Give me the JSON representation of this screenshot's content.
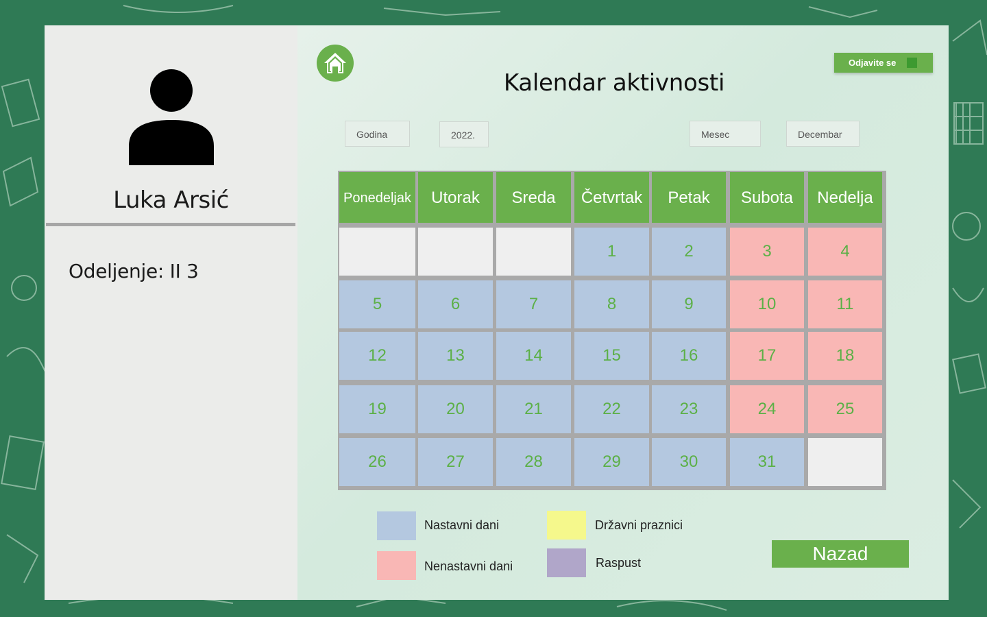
{
  "sidebar": {
    "user_name": "Luka Arsić",
    "class_label": "Odeljenje: II 3"
  },
  "header": {
    "title": "Kalendar aktivnosti",
    "logout_label": "Odjavite se"
  },
  "filters": {
    "year_label": "Godina",
    "year_value": "2022.",
    "month_label": "Mesec",
    "month_value": "Decembar"
  },
  "calendar": {
    "weekdays": [
      "Ponedeljak",
      "Utorak",
      "Sreda",
      "Četvrtak",
      "Petak",
      "Subota",
      "Nedelja"
    ],
    "weeks": [
      [
        {
          "day": "",
          "type": "empty"
        },
        {
          "day": "",
          "type": "empty"
        },
        {
          "day": "",
          "type": "empty"
        },
        {
          "day": "1",
          "type": "work"
        },
        {
          "day": "2",
          "type": "work"
        },
        {
          "day": "3",
          "type": "off"
        },
        {
          "day": "4",
          "type": "off"
        }
      ],
      [
        {
          "day": "5",
          "type": "work"
        },
        {
          "day": "6",
          "type": "work"
        },
        {
          "day": "7",
          "type": "work"
        },
        {
          "day": "8",
          "type": "work"
        },
        {
          "day": "9",
          "type": "work"
        },
        {
          "day": "10",
          "type": "off"
        },
        {
          "day": "11",
          "type": "off"
        }
      ],
      [
        {
          "day": "12",
          "type": "work"
        },
        {
          "day": "13",
          "type": "work"
        },
        {
          "day": "14",
          "type": "work"
        },
        {
          "day": "15",
          "type": "work"
        },
        {
          "day": "16",
          "type": "work"
        },
        {
          "day": "17",
          "type": "off"
        },
        {
          "day": "18",
          "type": "off"
        }
      ],
      [
        {
          "day": "19",
          "type": "work"
        },
        {
          "day": "20",
          "type": "work"
        },
        {
          "day": "21",
          "type": "work"
        },
        {
          "day": "22",
          "type": "work"
        },
        {
          "day": "23",
          "type": "work"
        },
        {
          "day": "24",
          "type": "off"
        },
        {
          "day": "25",
          "type": "off"
        }
      ],
      [
        {
          "day": "26",
          "type": "work"
        },
        {
          "day": "27",
          "type": "work"
        },
        {
          "day": "28",
          "type": "work"
        },
        {
          "day": "29",
          "type": "work"
        },
        {
          "day": "30",
          "type": "work"
        },
        {
          "day": "31",
          "type": "work"
        },
        {
          "day": "",
          "type": "empty"
        }
      ]
    ]
  },
  "legend": {
    "teaching_days": "Nastavni dani",
    "non_teaching_days": "Nenastavni dani",
    "public_holidays": "Državni praznici",
    "vacation": "Raspust",
    "colors": {
      "teaching_days": "#b4c8e0",
      "non_teaching_days": "#f9b7b5",
      "public_holidays": "#f5f88c",
      "vacation": "#b0a6c9"
    }
  },
  "back_label": "Nazad"
}
